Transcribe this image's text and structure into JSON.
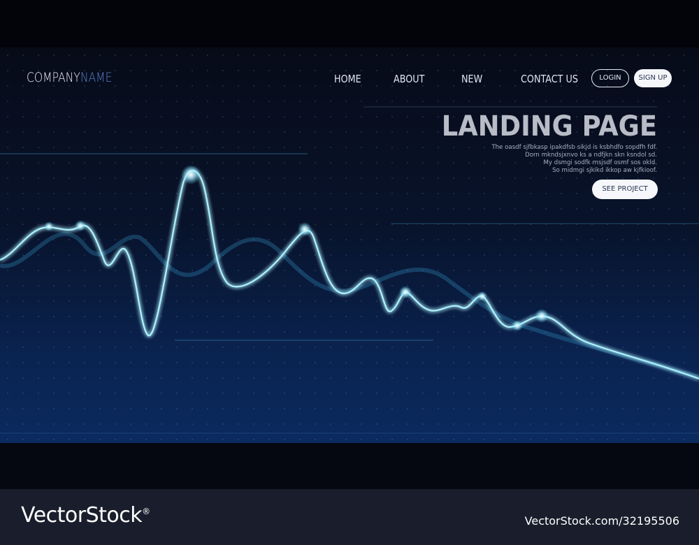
{
  "brand": {
    "part1": "COMPANY",
    "part2": "NAME"
  },
  "nav": {
    "items": [
      "HOME",
      "ABOUT",
      "NEW",
      "CONTACT US"
    ],
    "login_label": "LOGIN",
    "signup_label": "SIGN UP"
  },
  "hero": {
    "title": "LANDING PAGE",
    "body_lines": [
      "The oasdf sjfbkasp ipakdfsb sikjd is ksbhdfo sopdfh fdf.",
      "Dorn mkndsjxnvo ks a ndfjkn skn ksndol sd.",
      "My dsmgi sodfk msjsdf osmf sos okld.",
      "So midmgi sjkikd ikkop aw kjfkioof."
    ],
    "cta_label": "SEE PROJECT"
  },
  "watermark": {
    "logo": "VectorStock",
    "mark": "®",
    "id": "VectorStock.com/32195506"
  },
  "colors": {
    "accent": "#5b7fcb",
    "wave_glow": "#7ee6ff",
    "background": "#070b18"
  }
}
